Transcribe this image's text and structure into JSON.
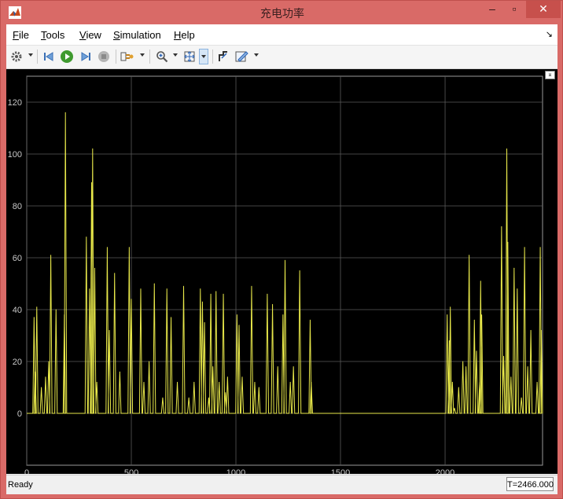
{
  "window": {
    "title": "充电功率"
  },
  "menu": [
    {
      "label": "File",
      "key": "F",
      "rest": "ile"
    },
    {
      "label": "Tools",
      "key": "T",
      "rest": "ools"
    },
    {
      "label": "View",
      "key": "V",
      "rest": "iew"
    },
    {
      "label": "Simulation",
      "key": "S",
      "rest": "imulation"
    },
    {
      "label": "Help",
      "key": "H",
      "rest": "elp"
    }
  ],
  "toolbar": [
    "gear-icon",
    "step-back-icon",
    "run-icon",
    "step-forward-icon",
    "stop-icon",
    "signal-select-icon",
    "zoom-icon",
    "fit-to-view-icon",
    "cursor-measure-icon",
    "style-icon"
  ],
  "status": {
    "text": "Ready",
    "time": "T=2466.000"
  },
  "colors": {
    "trace": "#e8e84a",
    "background": "#000000",
    "grid": "#5a5a5a"
  },
  "chart_data": {
    "type": "line",
    "title": "",
    "xlabel": "",
    "ylabel": "",
    "xlim": [
      0,
      2466
    ],
    "ylim": [
      -20,
      130
    ],
    "xticks": [
      0,
      500,
      1000,
      1500,
      2000
    ],
    "yticks": [
      0,
      20,
      40,
      60,
      80,
      100,
      120
    ],
    "grid": true,
    "series": [
      {
        "spikes": [
          [
            35,
            37
          ],
          [
            40,
            16
          ],
          [
            48,
            41
          ],
          [
            70,
            10
          ],
          [
            90,
            14
          ],
          [
            105,
            20
          ],
          [
            115,
            61
          ],
          [
            140,
            40
          ],
          [
            180,
            38
          ],
          [
            185,
            116
          ],
          [
            285,
            68
          ],
          [
            300,
            48
          ],
          [
            310,
            89
          ],
          [
            315,
            102
          ],
          [
            325,
            56
          ],
          [
            335,
            12
          ],
          [
            385,
            64
          ],
          [
            395,
            32
          ],
          [
            420,
            54
          ],
          [
            445,
            16
          ],
          [
            490,
            64
          ],
          [
            500,
            44
          ],
          [
            545,
            48
          ],
          [
            560,
            12
          ],
          [
            585,
            20
          ],
          [
            610,
            50
          ],
          [
            650,
            6
          ],
          [
            670,
            48
          ],
          [
            690,
            37
          ],
          [
            720,
            12
          ],
          [
            750,
            49
          ],
          [
            775,
            6
          ],
          [
            800,
            12
          ],
          [
            830,
            48
          ],
          [
            840,
            43
          ],
          [
            850,
            35
          ],
          [
            870,
            6
          ],
          [
            880,
            46
          ],
          [
            890,
            18
          ],
          [
            905,
            47
          ],
          [
            920,
            12
          ],
          [
            940,
            46
          ],
          [
            950,
            8
          ],
          [
            960,
            14
          ],
          [
            1005,
            38
          ],
          [
            1015,
            34
          ],
          [
            1030,
            14
          ],
          [
            1075,
            49
          ],
          [
            1090,
            12
          ],
          [
            1110,
            10
          ],
          [
            1150,
            46
          ],
          [
            1175,
            42
          ],
          [
            1200,
            18
          ],
          [
            1225,
            38
          ],
          [
            1235,
            59
          ],
          [
            1260,
            12
          ],
          [
            1275,
            18
          ],
          [
            1305,
            55
          ],
          [
            1355,
            36
          ],
          [
            1360,
            12
          ],
          [
            2010,
            38
          ],
          [
            2020,
            28
          ],
          [
            2025,
            41
          ],
          [
            2035,
            12
          ],
          [
            2045,
            2
          ],
          [
            2065,
            10
          ],
          [
            2085,
            20
          ],
          [
            2100,
            18
          ],
          [
            2115,
            61
          ],
          [
            2140,
            36
          ],
          [
            2150,
            24
          ],
          [
            2165,
            12
          ],
          [
            2170,
            51
          ],
          [
            2175,
            38
          ],
          [
            2270,
            72
          ],
          [
            2280,
            22
          ],
          [
            2295,
            102
          ],
          [
            2300,
            66
          ],
          [
            2315,
            14
          ],
          [
            2330,
            56
          ],
          [
            2345,
            48
          ],
          [
            2365,
            6
          ],
          [
            2380,
            64
          ],
          [
            2395,
            18
          ],
          [
            2410,
            32
          ],
          [
            2440,
            12
          ],
          [
            2455,
            64
          ],
          [
            2460,
            32
          ]
        ]
      }
    ]
  }
}
